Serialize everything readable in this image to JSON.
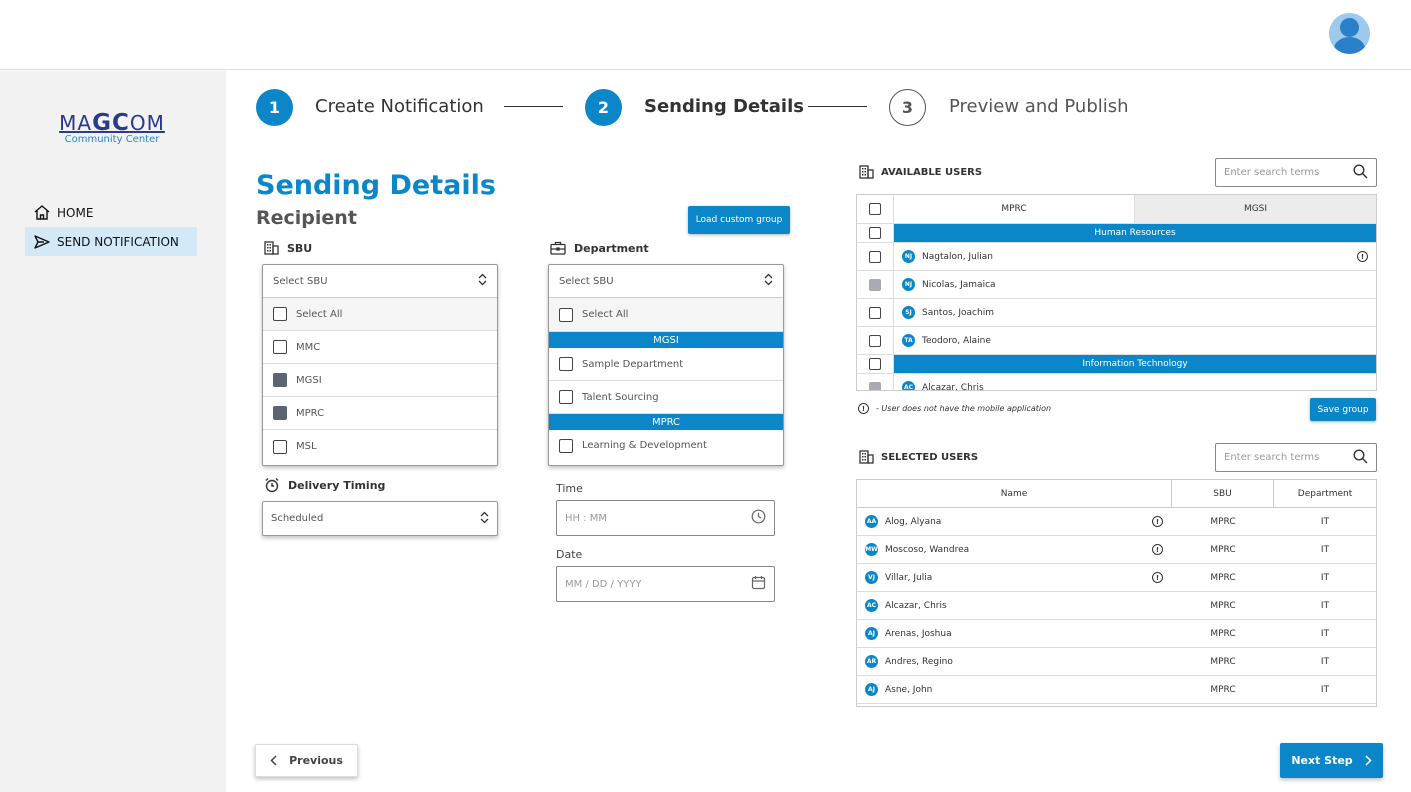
{
  "brand": {
    "logo_main_1": "MA",
    "logo_main_2": "GC",
    "logo_main_3": "OM",
    "logo_sub": "Community Center"
  },
  "nav": {
    "home": "HOME",
    "send": "SEND NOTIFICATION"
  },
  "stepper": [
    {
      "num": "1",
      "label": "Create Notification"
    },
    {
      "num": "2",
      "label": "Sending Details"
    },
    {
      "num": "3",
      "label": "Preview and Publish"
    }
  ],
  "section": {
    "title": "Sending Details",
    "subtitle": "Recipient"
  },
  "load_group_button": "Load custom group",
  "sbu": {
    "label": "SBU",
    "placeholder": "Select SBU",
    "options": [
      {
        "label": "Select All",
        "checked": false
      },
      {
        "label": "MMC",
        "checked": false
      },
      {
        "label": "MGSI",
        "checked": true
      },
      {
        "label": "MPRC",
        "checked": true
      },
      {
        "label": "MSL",
        "checked": false
      }
    ]
  },
  "department": {
    "label": "Department",
    "placeholder": "Select SBU",
    "select_all": "Select All",
    "group_mgsi": "MGSI",
    "sample_dept": "Sample Department",
    "talent": "Talent Sourcing",
    "group_mprc": "MPRC",
    "learning": "Learning & Development"
  },
  "delivery": {
    "label": "Delivery Timing",
    "value": "Scheduled"
  },
  "time": {
    "label": "Time",
    "placeholder": "HH : MM"
  },
  "date": {
    "label": "Date",
    "placeholder": "MM / DD / YYYY"
  },
  "available": {
    "title": "AVAILABLE USERS",
    "search_placeholder": "Enter search terms",
    "tabs": [
      "MPRC",
      "MGSI"
    ],
    "group_hr": "Human Resources",
    "group_it": "Information Technology",
    "users": [
      {
        "initials": "NJ",
        "name": "Nagtalon, Julian"
      },
      {
        "initials": "NJ",
        "name": "Nicolas, Jamaica"
      },
      {
        "initials": "SJ",
        "name": "Santos, Joachim"
      },
      {
        "initials": "TA",
        "name": "Teodoro, Alaine"
      },
      {
        "initials": "AC",
        "name": "Alcazar, Chris"
      }
    ],
    "legend_text": "- User does not have the mobile application",
    "save_button": "Save group"
  },
  "selected": {
    "title": "SELECTED USERS",
    "search_placeholder": "Enter search terms",
    "columns": [
      "Name",
      "SBU",
      "Department"
    ],
    "rows": [
      {
        "initials": "AA",
        "name": "Alog, Alyana",
        "sbu": "MPRC",
        "dept": "IT"
      },
      {
        "initials": "MW",
        "name": "Moscoso, Wandrea",
        "sbu": "MPRC",
        "dept": "IT"
      },
      {
        "initials": "VJ",
        "name": "Villar, Julia",
        "sbu": "MPRC",
        "dept": "IT"
      },
      {
        "initials": "AC",
        "name": "Alcazar, Chris",
        "sbu": "MPRC",
        "dept": "IT"
      },
      {
        "initials": "AJ",
        "name": "Arenas, Joshua",
        "sbu": "MPRC",
        "dept": "IT"
      },
      {
        "initials": "AR",
        "name": "Andres, Regino",
        "sbu": "MPRC",
        "dept": "IT"
      },
      {
        "initials": "AJ",
        "name": "Asne, John",
        "sbu": "MPRC",
        "dept": "IT"
      }
    ]
  },
  "footer": {
    "previous": "Previous",
    "next": "Next Step"
  },
  "colors": {
    "accent": "#0b87c9",
    "checked": "#5c6470",
    "sidebar": "#f2f2f2",
    "nav_active": "#d4e9f7"
  }
}
